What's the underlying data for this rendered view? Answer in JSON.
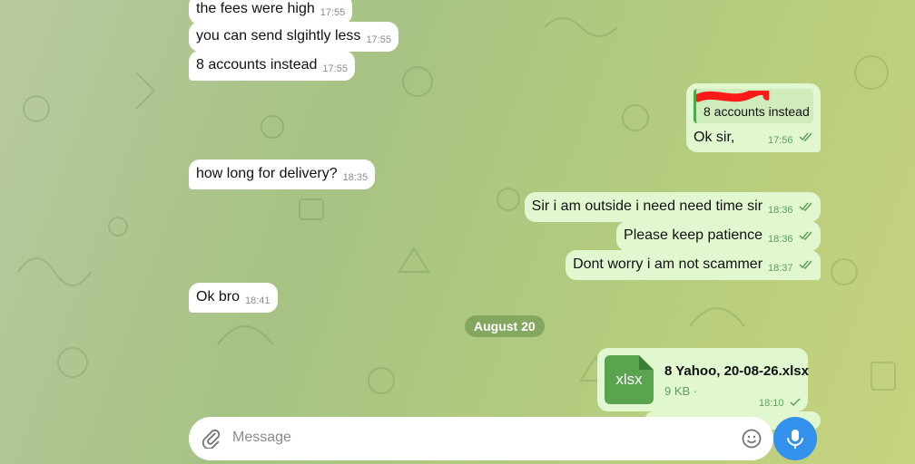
{
  "colors": {
    "incoming_bubble": "#ffffff",
    "outgoing_bubble": "#e1f7cf",
    "mic_button": "#3390ec",
    "file_icon": "#5aa34f"
  },
  "messages": {
    "m1": {
      "text": "the fees were high",
      "time": "17:55"
    },
    "m2": {
      "text": "you can send slgihtly less",
      "time": "17:55"
    },
    "m3": {
      "text": "8 accounts instead",
      "time": "17:55"
    },
    "m4": {
      "reply_quote": "8 accounts instead",
      "text": "Ok sir,",
      "time": "17:56"
    },
    "m5": {
      "text": "how long for delivery?",
      "time": "18:35"
    },
    "m6": {
      "text": "Sir i am outside i need need time sir",
      "time": "18:36"
    },
    "m7": {
      "text": "Please keep patience",
      "time": "18:36"
    },
    "m8": {
      "text": "Dont worry i am not scammer",
      "time": "18:37"
    },
    "m9": {
      "text": "Ok bro",
      "time": "18:41"
    }
  },
  "date_separator": "August 20",
  "file_message": {
    "icon_label": "xlsx",
    "file_name": "8 Yahoo, 20-08-26.xlsx",
    "file_size": "9 KB",
    "time": "18:10"
  },
  "composer": {
    "placeholder": "Message",
    "attach_icon": "paperclip-icon",
    "emoji_icon": "emoji-icon",
    "mic_icon": "microphone-icon"
  }
}
